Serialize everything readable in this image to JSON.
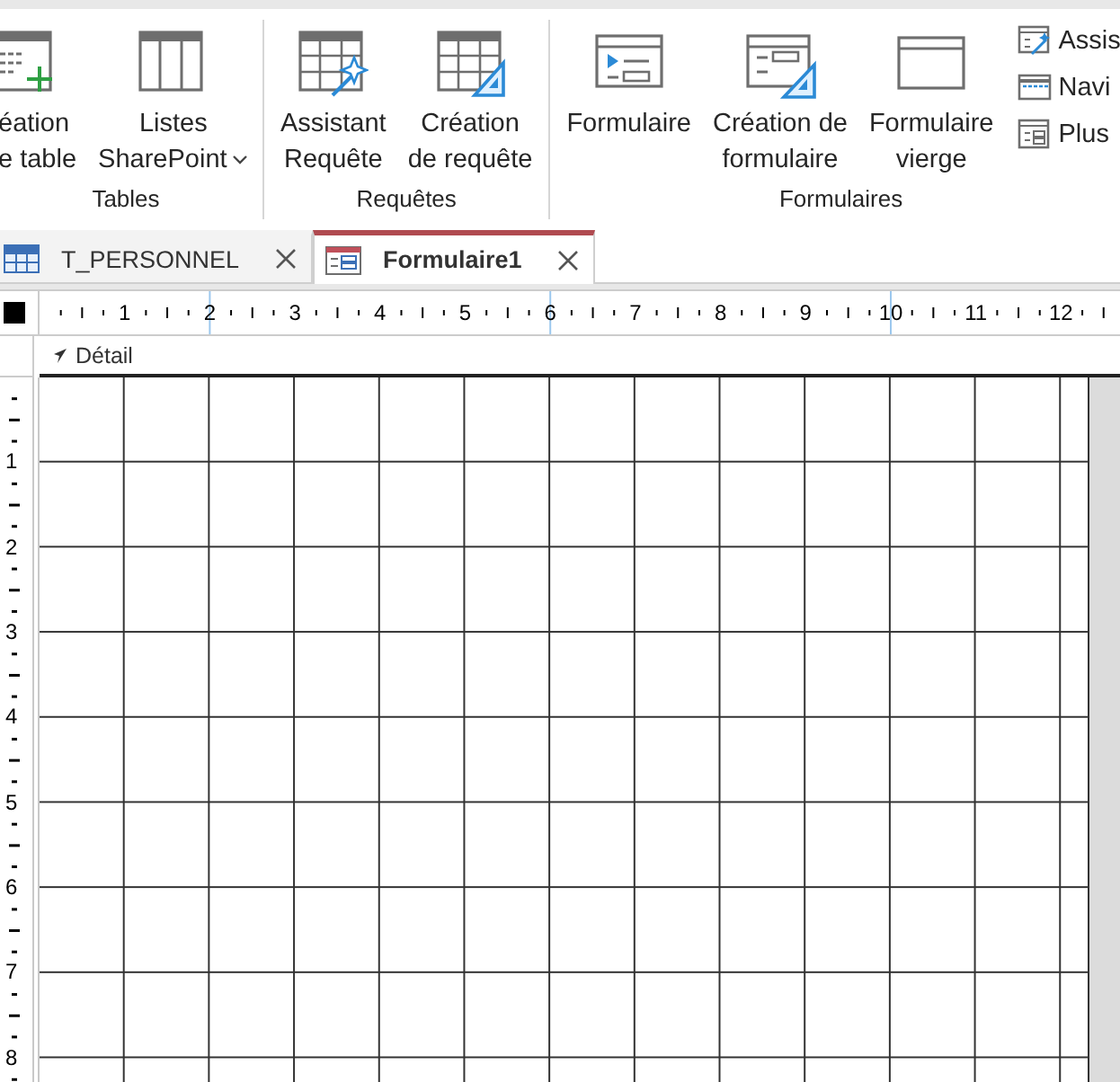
{
  "ribbon": {
    "groups": [
      {
        "label": "Tables",
        "buttons": [
          {
            "kind": "table-create",
            "lines": [
              "éation",
              "e table"
            ],
            "dropdown": false
          },
          {
            "kind": "list",
            "lines": [
              "Listes",
              "SharePoint"
            ],
            "dropdown": true
          }
        ]
      },
      {
        "label": "Requêtes",
        "buttons": [
          {
            "kind": "query-wizard",
            "lines": [
              "Assistant",
              "Requête"
            ],
            "dropdown": false
          },
          {
            "kind": "query-design",
            "lines": [
              "Création",
              "de requête"
            ],
            "dropdown": false
          }
        ]
      },
      {
        "label": "Formulaires",
        "buttons": [
          {
            "kind": "form",
            "lines": [
              "Formulaire"
            ],
            "dropdown": false
          },
          {
            "kind": "form-design",
            "lines": [
              "Création de",
              "formulaire"
            ],
            "dropdown": false
          },
          {
            "kind": "blank-form",
            "lines": [
              "Formulaire",
              "vierge"
            ],
            "dropdown": false
          }
        ],
        "small_buttons": [
          {
            "kind": "form-wizard",
            "label": "Assis"
          },
          {
            "kind": "navigation",
            "label": "Navi"
          },
          {
            "kind": "more-forms",
            "label": "Plus"
          }
        ]
      }
    ]
  },
  "document_tabs": [
    {
      "kind": "table",
      "label": "T_PERSONNEL",
      "selected": false
    },
    {
      "kind": "form",
      "label": "Formulaire1",
      "selected": true
    }
  ],
  "design_view": {
    "horizontal_ruler": [
      "1",
      "2",
      "3",
      "4",
      "5",
      "6",
      "7",
      "8",
      "9",
      "10",
      "11",
      "12"
    ],
    "vertical_ruler": [
      "1",
      "2",
      "3",
      "4",
      "5",
      "6",
      "7",
      "8"
    ],
    "section": {
      "label": "Détail"
    }
  }
}
